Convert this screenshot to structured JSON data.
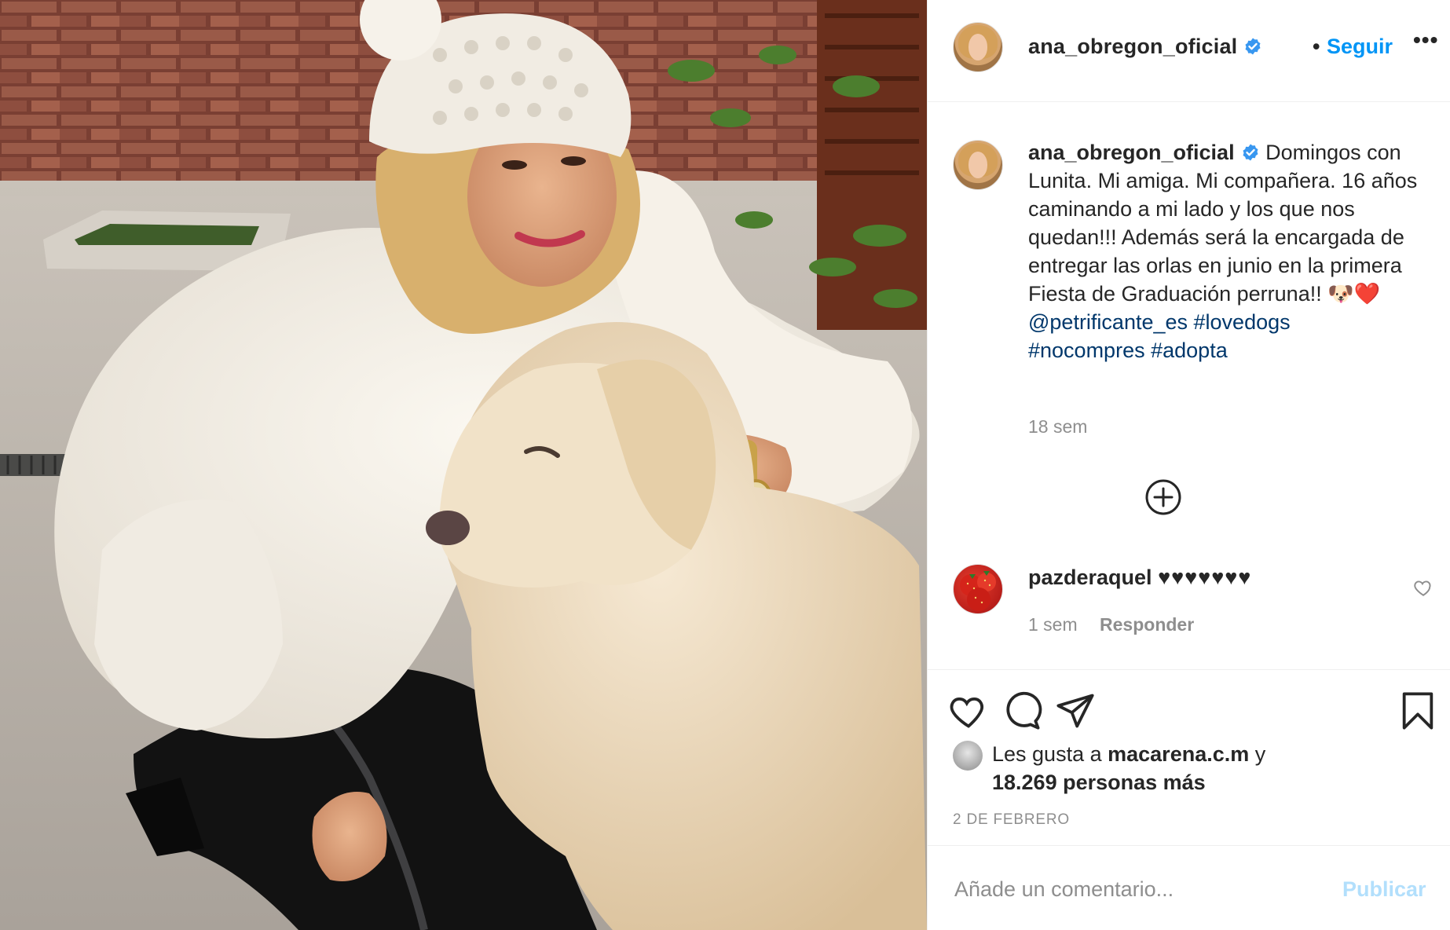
{
  "header": {
    "username": "ana_obregon_oficial",
    "separator": "•",
    "follow_label": "Seguir",
    "more_label": "•••"
  },
  "caption": {
    "username": "ana_obregon_oficial",
    "text": "Domingos con Lunita. Mi amiga. Mi compañera. 16 años caminando a mi lado y los que nos quedan!!! Además será la encargada de entregar las orlas en junio en la primera Fiesta de Graduación perruna!! 🐶❤️",
    "mention": "@petrificante_es",
    "hashtags": [
      "#lovedogs",
      "#nocompres",
      "#adopta"
    ],
    "time": "18 sem"
  },
  "comments": [
    {
      "username": "pazderaquel",
      "text": "♥♥♥♥♥♥♥",
      "time": "1 sem",
      "reply_label": "Responder"
    }
  ],
  "likes": {
    "prefix": "Les gusta a",
    "user": "macarena.c.m",
    "joiner": "y",
    "others": "18.269 personas más"
  },
  "date": "2 DE FEBRERO",
  "add_comment": {
    "placeholder": "Añade un comentario...",
    "post_label": "Publicar"
  },
  "icons": {
    "verified": "verified-badge-icon",
    "like": "heart-icon",
    "comment": "comment-bubble-icon",
    "share": "paper-plane-icon",
    "save": "bookmark-icon",
    "more_comments": "plus-circle-icon"
  },
  "colors": {
    "link": "#00376b",
    "follow": "#0095f6",
    "muted": "#8e8e8e",
    "publish_disabled": "#b2dffc",
    "verified": "#3897f0"
  }
}
